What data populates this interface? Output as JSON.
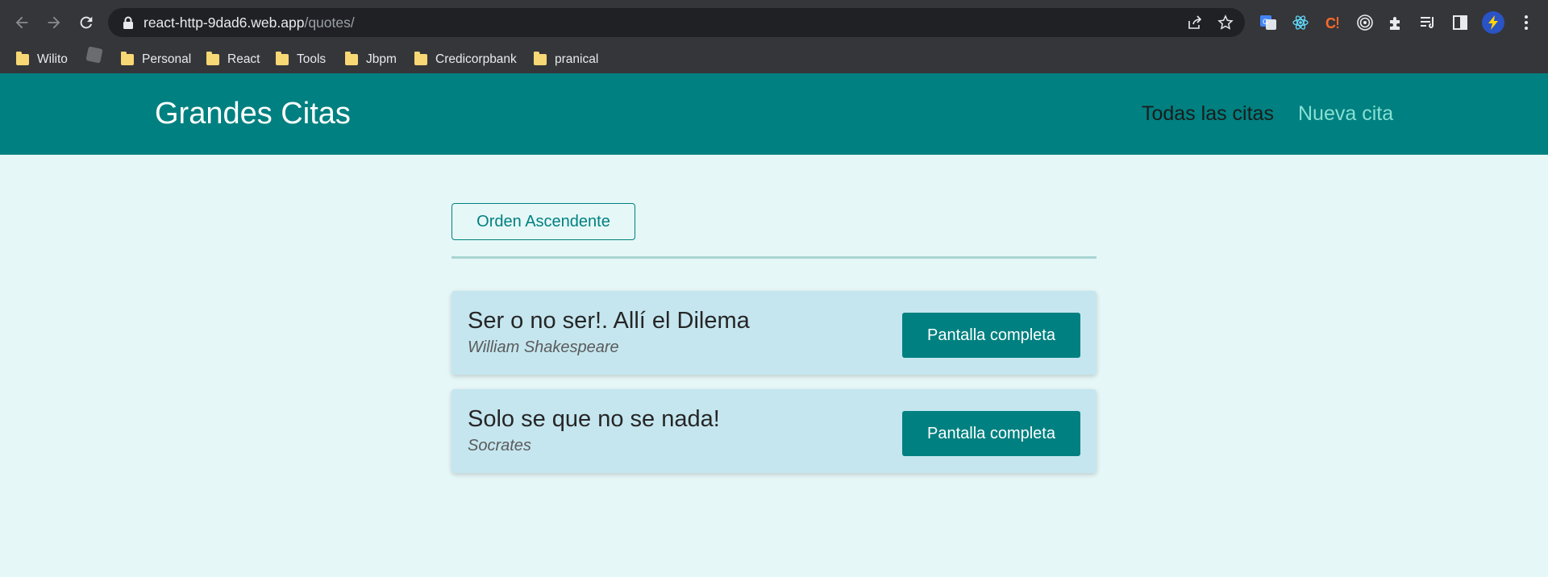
{
  "browser": {
    "url_host": "react-http-9dad6.web.app",
    "url_path": "/quotes/",
    "bookmarks": [
      "Wilito",
      "Personal",
      "React",
      "Tools",
      "Jbpm",
      "Credicorpbank",
      "pranical"
    ]
  },
  "app": {
    "title": "Grandes Citas",
    "nav": {
      "all_quotes": "Todas las citas",
      "new_quote": "Nueva cita"
    },
    "colors": {
      "primary": "#008080",
      "background": "#e6f7f7",
      "card": "#c5e6ef",
      "active_link": "#88dfd3"
    }
  },
  "main": {
    "sort_label": "Orden Ascendente",
    "quotes": [
      {
        "text": "Ser o no ser!. Allí el Dilema",
        "author": "William Shakespeare",
        "button": "Pantalla completa"
      },
      {
        "text": "Solo se que no se nada!",
        "author": "Socrates",
        "button": "Pantalla completa"
      }
    ]
  }
}
